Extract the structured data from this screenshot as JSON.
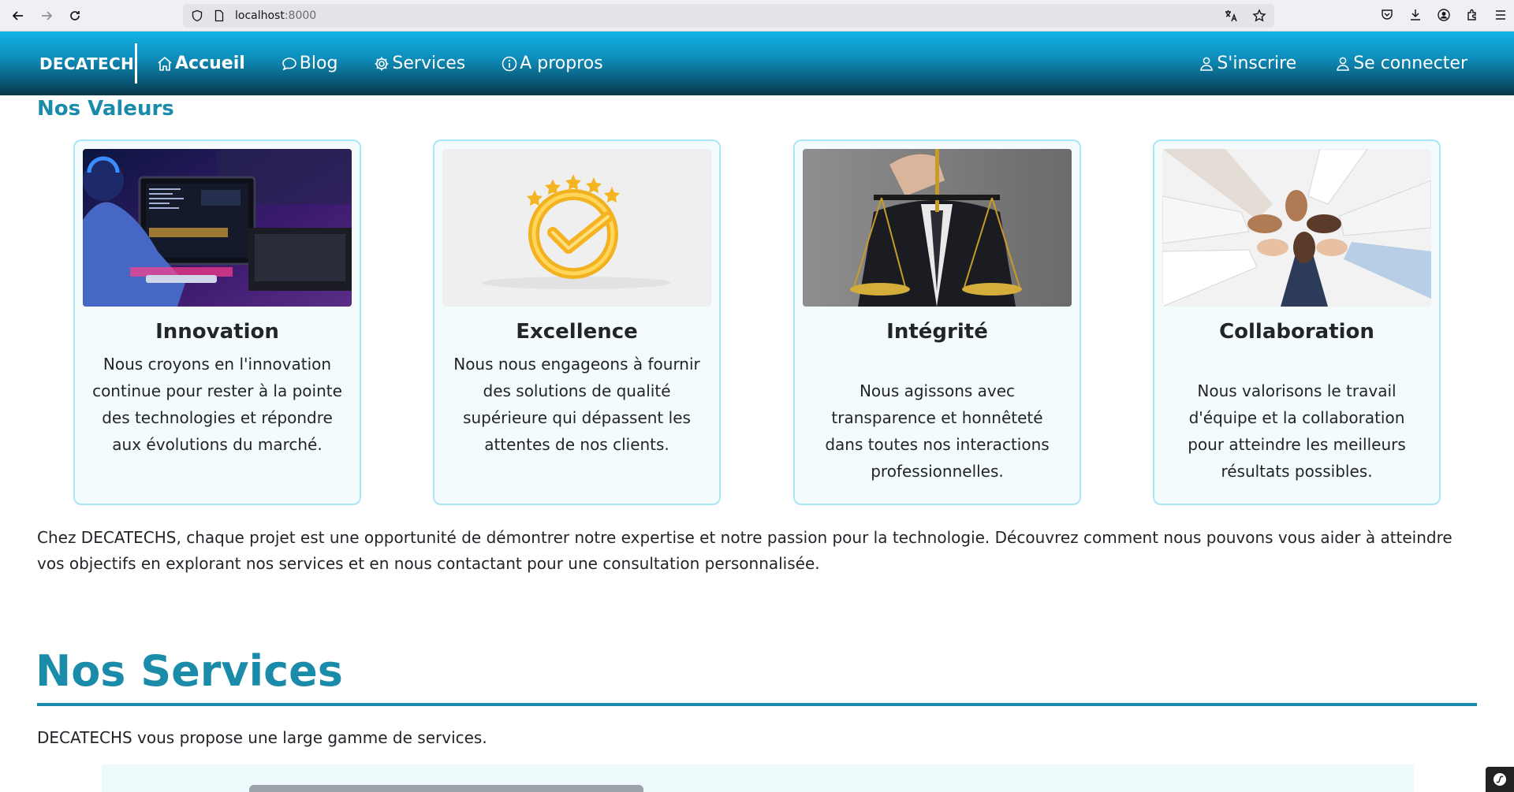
{
  "browser": {
    "url_host": "localhost",
    "url_port": ":8000"
  },
  "navbar": {
    "brand": "DECATECH",
    "links": [
      {
        "label": "Accueil",
        "icon": "home-icon"
      },
      {
        "label": "Blog",
        "icon": "chat-icon"
      },
      {
        "label": "Services",
        "icon": "gear-icon"
      },
      {
        "label": "A propros",
        "icon": "info-icon"
      }
    ],
    "right_links": [
      {
        "label": "S'inscrire",
        "icon": "person-icon"
      },
      {
        "label": "Se connecter",
        "icon": "person-icon"
      }
    ]
  },
  "values_section": {
    "title": "Nos Valeurs",
    "cards": [
      {
        "title": "Innovation",
        "text": "Nous croyons en l'innovation continue pour rester à la pointe des technologies et répondre aux évolutions du marché.",
        "image": "developer-at-computer-image"
      },
      {
        "title": "Excellence",
        "text": "Nous nous engageons à fournir des solutions de qualité supérieure qui dépassent les attentes de nos clients.",
        "image": "gold-check-stars-image"
      },
      {
        "title": "Intégrité",
        "text": "Nous agissons avec transparence et honnêteté dans toutes nos interactions professionnelles.",
        "image": "scales-of-justice-image"
      },
      {
        "title": "Collaboration",
        "text": "Nous valorisons le travail d'équipe et la collaboration pour atteindre les meilleurs résultats possibles.",
        "image": "joined-hands-image"
      }
    ]
  },
  "intro_paragraph": "Chez DECATECHS, chaque projet est une opportunité de démontrer notre expertise et notre passion pour la technologie. Découvrez comment nous pouvons vous aider à atteindre vos objectifs en explorant nos services et en nous contactant pour une consultation personnalisée.",
  "services_section": {
    "title": "Nos Services",
    "subtitle": "DECATECHS vous propose une large gamme de services."
  },
  "colors": {
    "accent": "#1a8ba9",
    "nav_top": "#12b4e6",
    "nav_bottom": "#083647",
    "card_border": "#a9e6f6"
  }
}
